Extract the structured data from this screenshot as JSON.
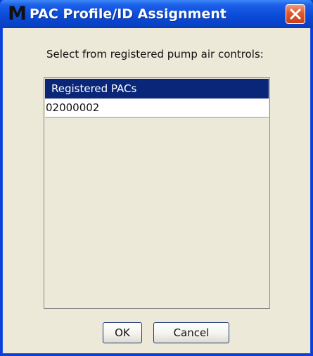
{
  "window": {
    "title": "PAC Profile/ID Assignment",
    "icon_glyph": "M",
    "icon_name": "app-logo-icon",
    "close_icon": "close-icon"
  },
  "prompt": "Select from registered pump air controls:",
  "list": {
    "header": "Registered PACs",
    "items": [
      "02000002"
    ]
  },
  "buttons": {
    "ok_label": "OK",
    "cancel_label": "Cancel"
  },
  "colors": {
    "titlebar": "#0a4bd9",
    "list_header_bg": "#0a2678",
    "dialog_bg": "#ece9d8",
    "close_button": "#e1582d"
  }
}
